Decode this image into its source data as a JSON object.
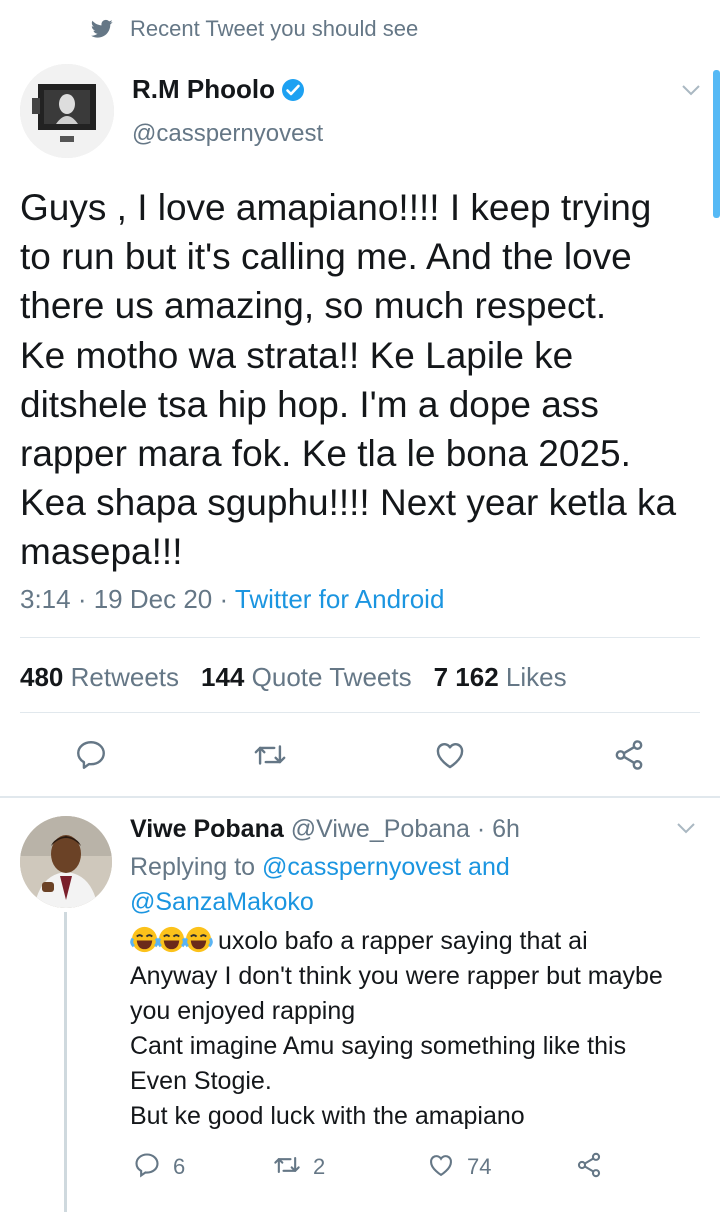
{
  "context": {
    "text": "Recent Tweet you should see",
    "icon": "twitter-bird-icon"
  },
  "tweet": {
    "author_name": "R.M Phoolo",
    "author_handle": "@casspernyovest",
    "verified": true,
    "text": "Guys , I love amapiano!!!! I keep trying\nto run but it's calling me. And the love\nthere us amazing, so much respect.\nKe motho wa strata!!  Ke Lapile ke\nditshele  tsa hip hop.  I'm a dope ass\nrapper mara fok. Ke tla le bona 2025.\nKea shapa sguphu!!!! Next year ketla ka\nmasepa!!!",
    "time": "3:14 · 19 Dec 20 · ",
    "source": "Twitter for Android",
    "stats": {
      "retweets_count": "480",
      "retweets_label": "Retweets",
      "quotes_count": "144",
      "quotes_label": "Quote Tweets",
      "likes_count": "7 162",
      "likes_label": "Likes"
    },
    "actions": [
      "reply-icon",
      "retweet-icon",
      "like-icon",
      "share-icon"
    ]
  },
  "reply": {
    "author_name": "Viwe Pobana",
    "author_handle": "@Viwe_Pobana · 6h",
    "replying_prefix": "Replying to ",
    "replying_user1": "@casspernyovest",
    "replying_and": " and",
    "replying_user2": "@SanzaMakoko",
    "first_line": "uxolo bafo a rapper saying that ai",
    "text": "Anyway I don't think you were rapper but maybe\nyou enjoyed rapping\nCant imagine Amu saying something like this\nEven Stogie.\nBut ke good luck with the amapiano",
    "emoji": "😂😂😂",
    "replies_count": "6",
    "retweets_count": "2",
    "likes_count": "74"
  },
  "colors": {
    "link": "#1b95e0",
    "muted": "#657786",
    "verified": "#1da1f2",
    "divider": "#e1e8ed"
  }
}
